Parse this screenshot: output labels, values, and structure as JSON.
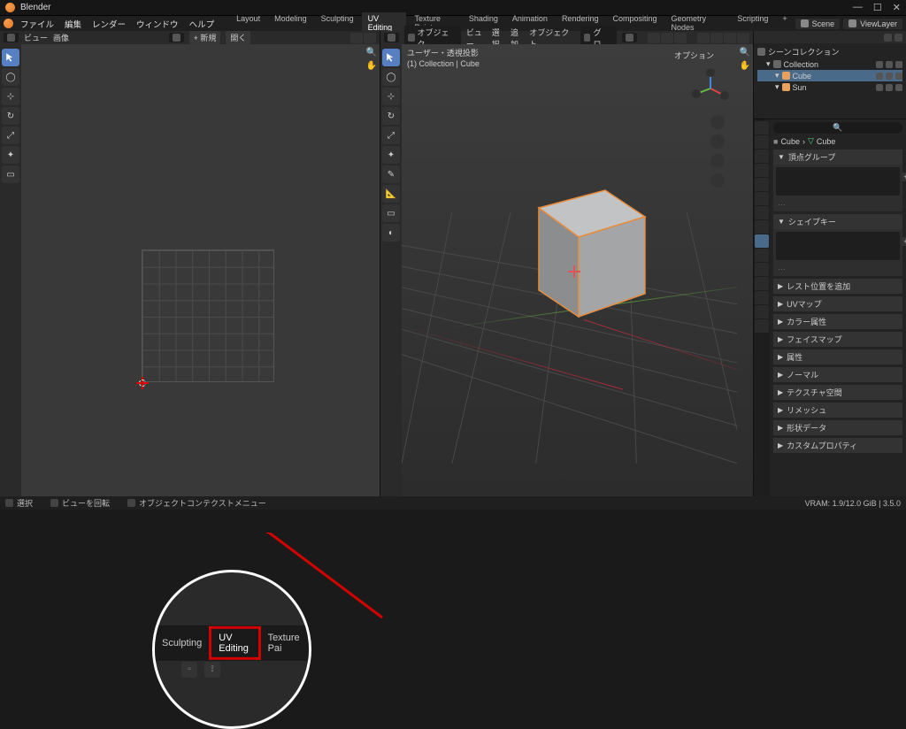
{
  "titlebar": {
    "title": "Blender"
  },
  "menus": [
    "ファイル",
    "編集",
    "レンダー",
    "ウィンドウ",
    "ヘルプ"
  ],
  "workspaces": [
    "Layout",
    "Modeling",
    "Sculpting",
    "UV Editing",
    "Texture Paint",
    "Shading",
    "Animation",
    "Rendering",
    "Compositing",
    "Geometry Nodes",
    "Scripting"
  ],
  "workspace_active": "UV Editing",
  "scene_sel": "Scene",
  "viewlayer_sel": "ViewLayer",
  "uv_editor": {
    "menu": [
      "ビュー",
      "画像"
    ],
    "new_btn": "+ 新規",
    "open_btn": "開く"
  },
  "viewport3d": {
    "mode": "オブジェク…",
    "menu": [
      "ビュー",
      "選択",
      "追加",
      "オブジェクト"
    ],
    "global": "グロ…",
    "options_label": "オプション",
    "overlay": {
      "line1": "ユーザー・透視投影",
      "line2": "(1) Collection | Cube"
    }
  },
  "outliner": {
    "root": "シーンコレクション",
    "items": [
      {
        "label": "Collection",
        "indent": 1,
        "sel": false
      },
      {
        "label": "Cube",
        "indent": 2,
        "sel": true,
        "color": "#e8a05e"
      },
      {
        "label": "Sun",
        "indent": 2,
        "sel": false,
        "color": "#e8a05e"
      }
    ]
  },
  "props": {
    "search_placeholder": "",
    "crumb": [
      "Cube",
      "Cube"
    ],
    "panels": [
      {
        "label": "頂点グループ",
        "open": true,
        "type": "empty"
      },
      {
        "label": "シェイプキー",
        "open": true,
        "type": "empty"
      },
      {
        "label": "レスト位置を追加",
        "open": false,
        "type": "row"
      },
      {
        "label": "UVマップ",
        "open": false,
        "type": "row"
      },
      {
        "label": "カラー属性",
        "open": false,
        "type": "row"
      },
      {
        "label": "フェイスマップ",
        "open": false,
        "type": "row"
      },
      {
        "label": "属性",
        "open": false,
        "type": "row"
      },
      {
        "label": "ノーマル",
        "open": false,
        "type": "row"
      },
      {
        "label": "テクスチャ空間",
        "open": false,
        "type": "row"
      },
      {
        "label": "リメッシュ",
        "open": false,
        "type": "row"
      },
      {
        "label": "形状データ",
        "open": false,
        "type": "row"
      },
      {
        "label": "カスタムプロパティ",
        "open": false,
        "type": "row"
      }
    ]
  },
  "statusbar": {
    "left1": "選択",
    "left2": "ビューを回転",
    "left3": "オブジェクトコンテクストメニュー",
    "right": "VRAM: 1.9/12.0 GiB | 3.5.0"
  },
  "zoom_tabs": [
    "Sculpting",
    "UV Editing",
    "Texture Pai"
  ]
}
